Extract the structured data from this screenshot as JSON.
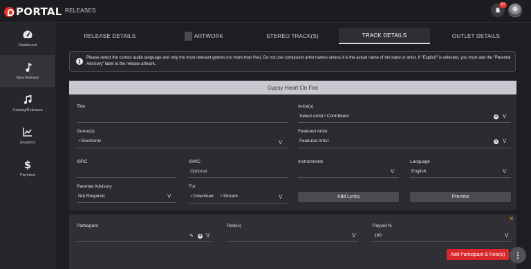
{
  "app": {
    "logo_text": "PORTAL",
    "page_label": "RELEASES",
    "notification_count": "9+"
  },
  "sidebar": {
    "items": [
      {
        "label": "Dashboard",
        "icon": "dashboard-icon"
      },
      {
        "label": "New Release",
        "icon": "music-note-icon",
        "active": true
      },
      {
        "label": "Catalog/Releases",
        "icon": "music-notes-icon"
      },
      {
        "label": "Analytics",
        "icon": "analytics-icon"
      },
      {
        "label": "Payment",
        "icon": "dollar-icon"
      }
    ]
  },
  "tabs": [
    {
      "label": "RELEASE DETAILS"
    },
    {
      "label": "ARTWORK"
    },
    {
      "label": "STEREO TRACK(S)"
    },
    {
      "label": "TRACK DETAILS",
      "active": true
    },
    {
      "label": "OUTLET DETAILS"
    }
  ],
  "info": {
    "text": "Please select the correct audio language and only the most relevant genres (no more than five). Do not use compound artist names unless it is the actual name of the band or artist. If \"Explicit\" is selected, you must add the \"Parental Advisory\" label to the release artwork."
  },
  "track": {
    "title": "Gypsy Heart On Fire",
    "fields": {
      "title_label": "Title",
      "title_value": "",
      "artists_label": "Artist(s)",
      "artists_value": "Select Artist / Contributor",
      "genres_label": "Genre(s)",
      "genre_chip": "Electronic",
      "featured_label": "Featured Artist",
      "featured_value": "Featured Artist",
      "isrc_label": "ISRC",
      "iswc_label": "ISWC",
      "iswc_value": "Optional",
      "instrumental_label": "Instrumental",
      "language_label": "Language",
      "language_value": "English",
      "parental_label": "Parental Advisory",
      "parental_value": "Not Required",
      "for_label": "For",
      "for_chips": [
        "Download",
        "Stream"
      ]
    },
    "buttons": {
      "add_lyrics": "Add Lyrics",
      "preview": "Preview"
    }
  },
  "participants": {
    "participant_label": "Participant",
    "roles_label": "Role(s)",
    "payout_label": "Payout %",
    "payout_value": "100",
    "add_button": "Add Participant & Role(s)"
  },
  "colors": {
    "accent_red": "#d8262a",
    "close_orange": "#e08a2a",
    "card_header": "#c8c8d0"
  }
}
